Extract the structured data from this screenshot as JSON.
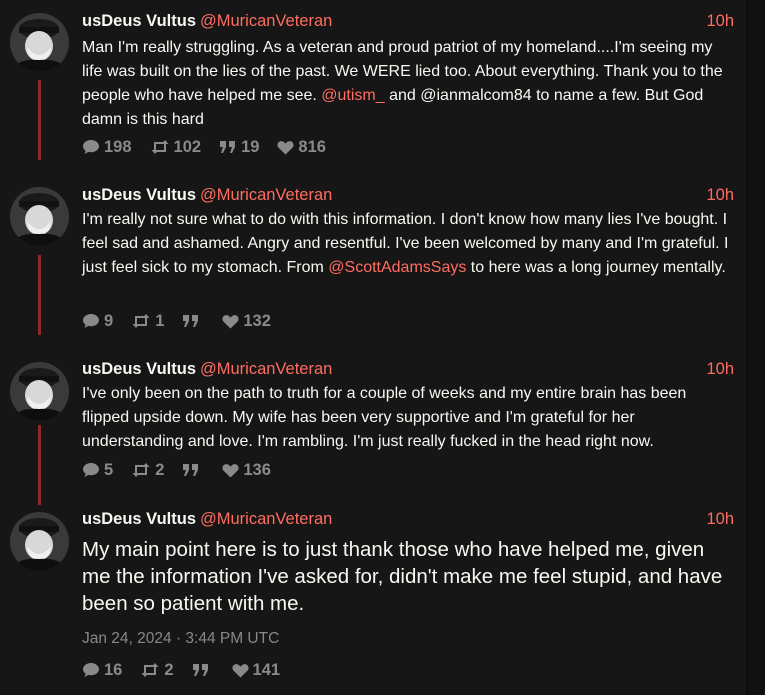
{
  "tweets": [
    {
      "display_name": "usDeus Vultus",
      "handle": "@MuricanVeteran",
      "time": "10h",
      "text_parts": [
        "Man I'm really struggling. As a veteran and proud patriot of my homeland....I'm seeing my life was built on the lies of the past. We WERE lied too. About everything. Thank you to the people who have helped me see. ",
        "@utism_",
        " and @ianmalcom84 to name a few. But God damn is this hard"
      ],
      "stats": {
        "replies": "198",
        "retweets": "102",
        "quotes": "19",
        "likes": "816"
      }
    },
    {
      "display_name": "usDeus Vultus",
      "handle": "@MuricanVeteran",
      "time": "10h",
      "text_parts": [
        "I'm really not sure what to do with this information. I don't know how many lies I've bought. I feel sad and ashamed. Angry and resentful. I've been welcomed by many and I'm grateful. I just feel sick to my stomach. From ",
        "@ScottAdamsSays",
        " to here was a long journey mentally."
      ],
      "stats": {
        "replies": "9",
        "retweets": "1",
        "quotes": "",
        "likes": "132"
      }
    },
    {
      "display_name": "usDeus Vultus",
      "handle": "@MuricanVeteran",
      "time": "10h",
      "text": "I've only been on the path to truth for a couple of weeks and my entire brain has been flipped upside down. My wife has been very supportive and I'm grateful for her understanding and love. I'm rambling. I'm just really fucked in the head right now.",
      "stats": {
        "replies": "5",
        "retweets": "2",
        "quotes": "",
        "likes": "136"
      }
    },
    {
      "display_name": "usDeus Vultus",
      "handle": "@MuricanVeteran",
      "time": "10h",
      "text": "My main point here is to just thank those who have helped me, given me the information I've asked for, didn't make me feel stupid, and have been so patient with me.",
      "date": "Jan 24, 2024 · 3:44 PM UTC",
      "stats": {
        "replies": "16",
        "retweets": "2",
        "quotes": "",
        "likes": "141"
      }
    }
  ],
  "icons": {
    "reply": "comment-bubble-icon",
    "retweet": "retweet-icon",
    "quote": "quote-icon",
    "like": "heart-icon"
  },
  "colors": {
    "background": "#161616",
    "accent": "#ff6c60",
    "thread_line": "#8f2a26",
    "muted": "#8a8a8a"
  }
}
